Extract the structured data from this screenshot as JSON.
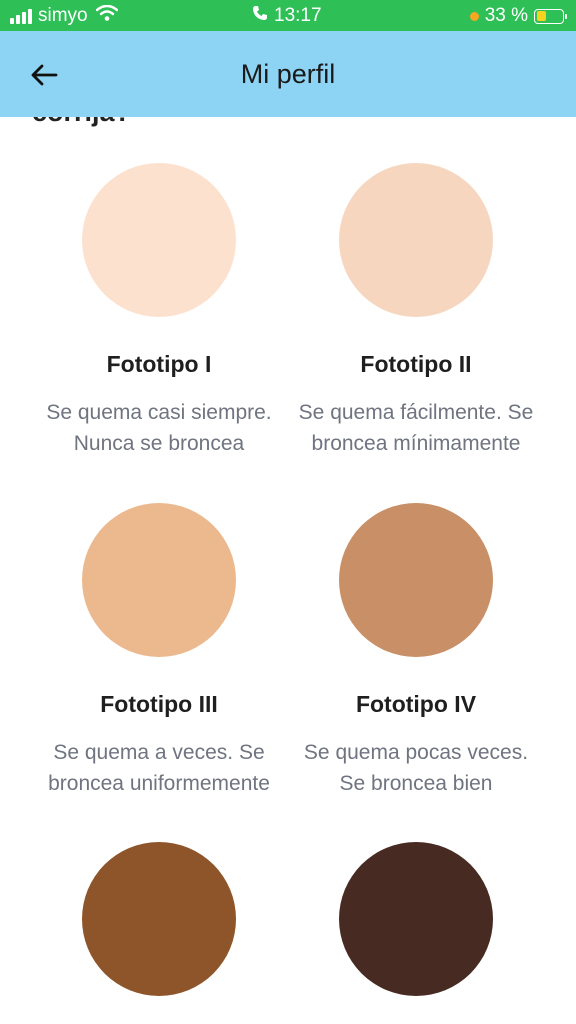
{
  "status_bar": {
    "carrier": "simyo",
    "time": "13:17",
    "battery": "33 %",
    "battery_level": 0.33
  },
  "app_bar": {
    "title": "Mi perfil",
    "back_icon": "arrow-left-icon"
  },
  "section_title_partial": "corrija?",
  "phototypes": [
    {
      "title": "Fototipo I",
      "description": "Se quema casi siempre. Nunca se broncea",
      "color": "#fde1cf"
    },
    {
      "title": "Fototipo II",
      "description": "Se quema fácilmente. Se broncea mínimamente",
      "color": "#f7d6c0"
    },
    {
      "title": "Fototipo III",
      "description": "Se quema a veces. Se broncea uniformemente",
      "color": "#ecb98f"
    },
    {
      "title": "Fototipo IV",
      "description": "Se quema pocas veces. Se broncea bien",
      "color": "#c98f66"
    },
    {
      "title": "",
      "description": "",
      "color": "#8e552a"
    },
    {
      "title": "",
      "description": "",
      "color": "#472b22"
    }
  ]
}
